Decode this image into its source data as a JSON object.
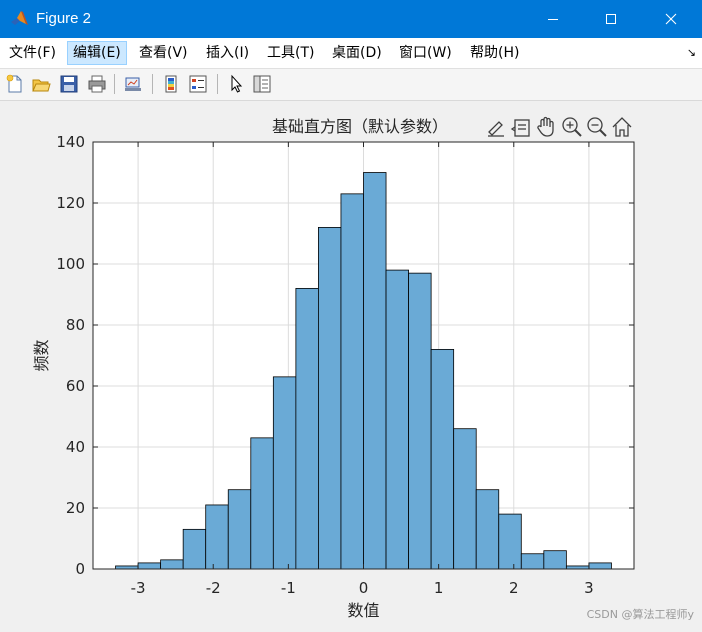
{
  "window": {
    "title": "Figure 2",
    "accent": "#0078d7"
  },
  "menu": {
    "items": [
      "文件(F)",
      "编辑(E)",
      "查看(V)",
      "插入(I)",
      "工具(T)",
      "桌面(D)",
      "窗口(W)",
      "帮助(H)"
    ],
    "active_index": 1
  },
  "toolbar": {
    "icons": [
      "new-figure-icon",
      "open-file-icon",
      "save-icon",
      "print-icon",
      "link-plot-icon",
      "colorbar-icon",
      "legend-icon",
      "select-pointer-icon",
      "property-inspector-icon"
    ]
  },
  "axes_toolbar": {
    "icons": [
      "brush-icon",
      "data-tips-icon",
      "pan-hand-icon",
      "zoom-in-icon",
      "zoom-out-icon",
      "home-icon"
    ]
  },
  "watermark": "CSDN @算法工程师y",
  "chart_data": {
    "type": "bar",
    "title": "基础直方图（默认参数）",
    "xlabel": "数值",
    "ylabel": "频数",
    "bin_edges": [
      -3.3,
      -3.0,
      -2.7,
      -2.4,
      -2.1,
      -1.8,
      -1.5,
      -1.2,
      -0.9,
      -0.6,
      -0.3,
      0.0,
      0.3,
      0.6,
      0.9,
      1.2,
      1.5,
      1.8,
      2.1,
      2.4,
      2.7,
      3.0,
      3.3
    ],
    "counts": [
      1,
      2,
      3,
      13,
      21,
      26,
      43,
      63,
      92,
      112,
      123,
      130,
      98,
      97,
      72,
      46,
      26,
      18,
      5,
      6,
      1,
      2
    ],
    "xlim": [
      -3.6,
      3.6
    ],
    "ylim": [
      0,
      140
    ],
    "xticks": [
      -3,
      -2,
      -1,
      0,
      1,
      2,
      3
    ],
    "yticks": [
      0,
      20,
      40,
      60,
      80,
      100,
      120,
      140
    ],
    "grid": true,
    "bar_color": "#6aaad6",
    "edge_color": "#000000"
  }
}
